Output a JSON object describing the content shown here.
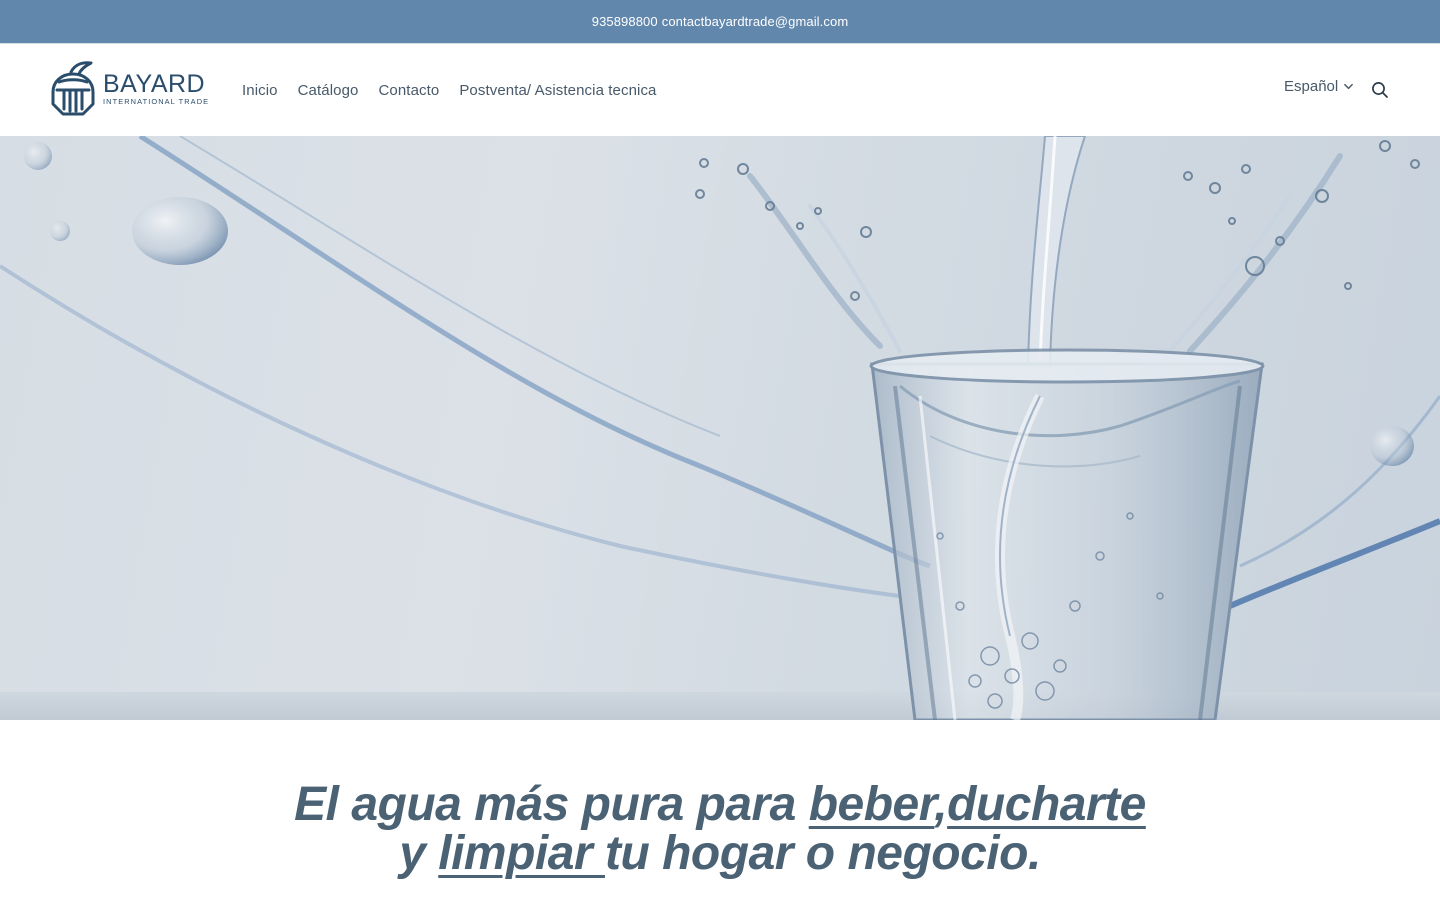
{
  "announcement": {
    "phone": "935898800",
    "email": "contactbayardtrade@gmail.com"
  },
  "header": {
    "logo": {
      "word": "BAYARD",
      "tagline": "INTERNATIONAL TRADE",
      "icon": "knight-helmet-logo"
    },
    "nav": [
      {
        "label": "Inicio"
      },
      {
        "label": "Catálogo"
      },
      {
        "label": "Contacto"
      },
      {
        "label": "Postventa/ Asistencia tecnica"
      }
    ],
    "language": {
      "selected": "Español",
      "icon": "chevron-down-icon"
    },
    "search_icon": "search-icon"
  },
  "hero": {
    "image": "water-pouring-into-glass"
  },
  "headline": {
    "part1": "El agua más pura para ",
    "link1": "beber",
    "sep": ",",
    "link2": "ducharte",
    "part2": "y ",
    "link3": "limpiar ",
    "part3": "tu hogar o negocio."
  },
  "colors": {
    "announcement_bg": "#6187ad",
    "brand": "#2a4d6b",
    "nav_text": "#48596a",
    "headline": "#4a6274"
  }
}
